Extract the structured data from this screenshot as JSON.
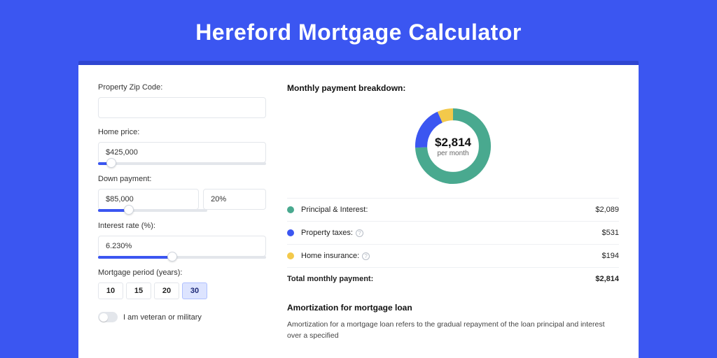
{
  "page": {
    "title": "Hereford Mortgage Calculator"
  },
  "form": {
    "zip_label": "Property Zip Code:",
    "zip_value": "",
    "home_price_label": "Home price:",
    "home_price_value": "$425,000",
    "home_price_slider_pct": 8,
    "down_payment_label": "Down payment:",
    "down_payment_value": "$85,000",
    "down_payment_pct_value": "20%",
    "down_payment_slider_pct": 28,
    "interest_label": "Interest rate (%):",
    "interest_value": "6.230%",
    "interest_slider_pct": 44,
    "period_label": "Mortgage period (years):",
    "period_options": [
      "10",
      "15",
      "20",
      "30"
    ],
    "period_selected_index": 3,
    "veteran_label": "I am veteran or military",
    "veteran_on": false
  },
  "breakdown": {
    "title": "Monthly payment breakdown:",
    "center_amount": "$2,814",
    "center_sub": "per month",
    "rows": [
      {
        "label": "Principal & Interest:",
        "value": "$2,089",
        "info": false
      },
      {
        "label": "Property taxes:",
        "value": "$531",
        "info": true
      },
      {
        "label": "Home insurance:",
        "value": "$194",
        "info": true
      }
    ],
    "total_label": "Total monthly payment:",
    "total_value": "$2,814",
    "colors": {
      "principal": "#49A98F",
      "taxes": "#3B56F1",
      "insurance": "#F3C94B"
    }
  },
  "chart_data": {
    "type": "pie",
    "title": "Monthly payment breakdown",
    "series": [
      {
        "name": "Principal & Interest",
        "value": 2089,
        "color": "#49A98F"
      },
      {
        "name": "Property taxes",
        "value": 531,
        "color": "#3B56F1"
      },
      {
        "name": "Home insurance",
        "value": 194,
        "color": "#F3C94B"
      }
    ],
    "total": 2814
  },
  "amortization": {
    "title": "Amortization for mortgage loan",
    "text": "Amortization for a mortgage loan refers to the gradual repayment of the loan principal and interest over a specified"
  }
}
